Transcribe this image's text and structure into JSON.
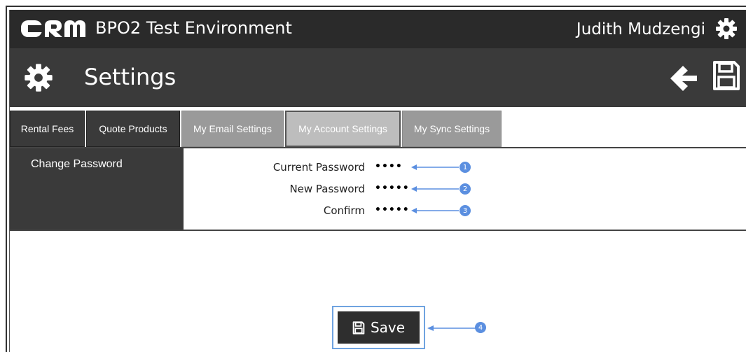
{
  "header": {
    "logo_text": "CRM",
    "environment_title": "BPO2 Test Environment",
    "user_name": "Judith Mudzengi"
  },
  "page": {
    "title": "Settings"
  },
  "tabs": [
    {
      "label": "Rental Fees",
      "style": "dark"
    },
    {
      "label": "Quote Products",
      "style": "dark"
    },
    {
      "label": "My Email Settings",
      "style": "light"
    },
    {
      "label": "My Account Settings",
      "style": "active"
    },
    {
      "label": "My Sync Settings",
      "style": "light"
    }
  ],
  "section": {
    "title": "Change Password",
    "fields": [
      {
        "label": "Current Password",
        "value": "••••",
        "annotation": "1"
      },
      {
        "label": "New Password",
        "value": "•••••",
        "annotation": "2"
      },
      {
        "label": "Confirm",
        "value": "•••••",
        "annotation": "3"
      }
    ]
  },
  "save_button": {
    "label": "Save",
    "annotation": "4"
  },
  "colors": {
    "header_bg": "#2a2a2a",
    "subheader_bg": "#3a3a3a",
    "annotation_blue": "#5b8fe0"
  }
}
